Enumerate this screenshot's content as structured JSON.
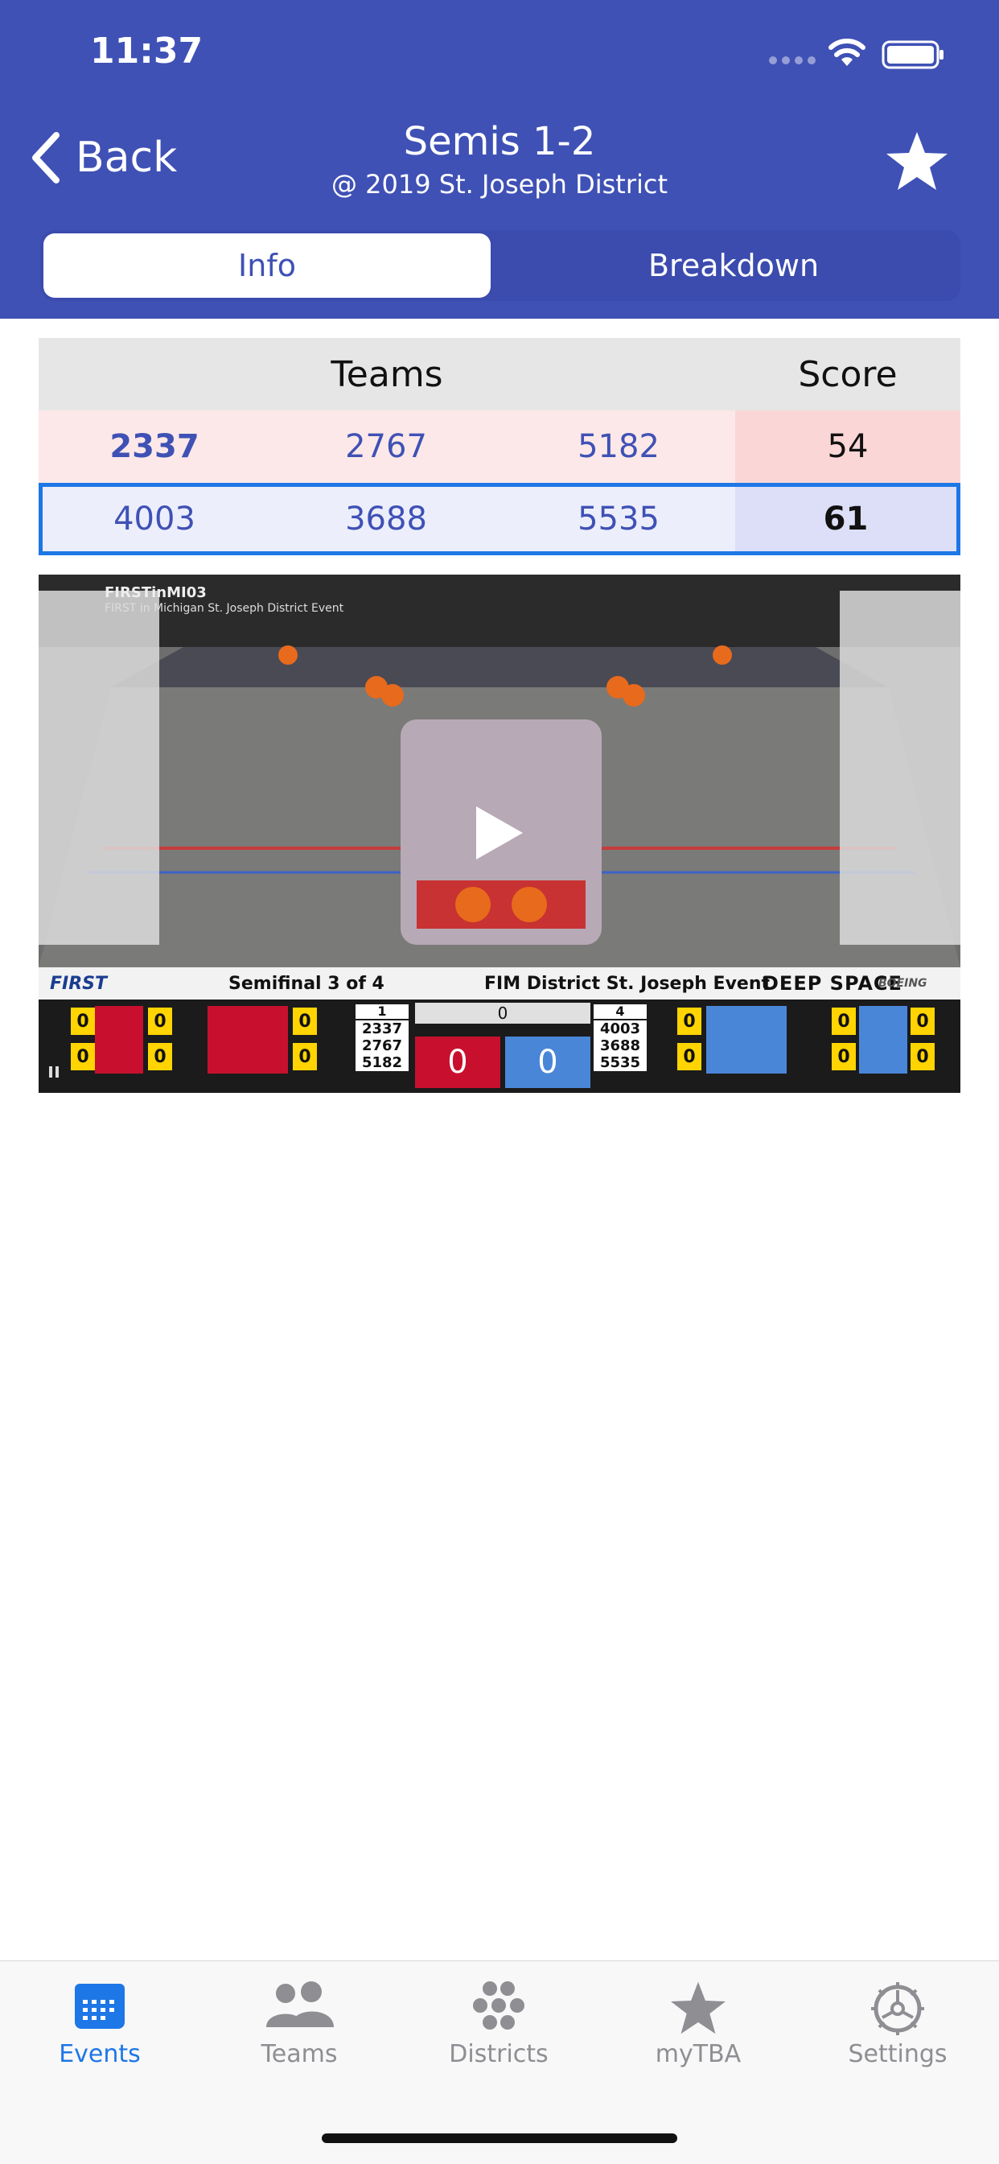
{
  "status_bar": {
    "time": "11:37"
  },
  "nav": {
    "back_label": "Back",
    "title": "Semis 1-2",
    "subtitle": "@ 2019 St. Joseph District"
  },
  "segments": {
    "info": "Info",
    "breakdown": "Breakdown",
    "selected": "Info"
  },
  "score_table": {
    "headers": {
      "teams": "Teams",
      "score": "Score"
    },
    "red": {
      "teams": [
        "2337",
        "2767",
        "5182"
      ],
      "score": "54"
    },
    "blue": {
      "teams": [
        "4003",
        "3688",
        "5535"
      ],
      "score": "61"
    }
  },
  "video": {
    "channel": "FIRSTinMI03",
    "subtitle": "FIRST in Michigan St. Joseph District Event",
    "overlay": {
      "brand": "FIRST",
      "match": "Semifinal 3 of 4",
      "event": "FIM District St. Joseph Event",
      "game": "DEEP SPACE",
      "sponsor": "BOEING",
      "red_seed": "1",
      "blue_seed": "4",
      "red_teams": [
        "2337",
        "2767",
        "5182"
      ],
      "blue_teams": [
        "4003",
        "3688",
        "5535"
      ],
      "red_score": "0",
      "blue_score": "0",
      "center_score": "0",
      "counters": [
        "0",
        "0",
        "0",
        "0",
        "0",
        "0",
        "0",
        "0",
        "0",
        "0",
        "0",
        "0"
      ]
    }
  },
  "tab_bar": {
    "items": [
      {
        "label": "Events",
        "icon": "calendar-icon",
        "active": true
      },
      {
        "label": "Teams",
        "icon": "people-icon",
        "active": false
      },
      {
        "label": "Districts",
        "icon": "dots-icon",
        "active": false
      },
      {
        "label": "myTBA",
        "icon": "star-icon",
        "active": false
      },
      {
        "label": "Settings",
        "icon": "gear-icon",
        "active": false
      }
    ]
  },
  "colors": {
    "brand": "#3f51b5",
    "active_tab": "#1e77e6",
    "inactive_tab": "#8e8e93",
    "red_alliance": "#fce8e8",
    "blue_alliance": "#eceefb"
  }
}
